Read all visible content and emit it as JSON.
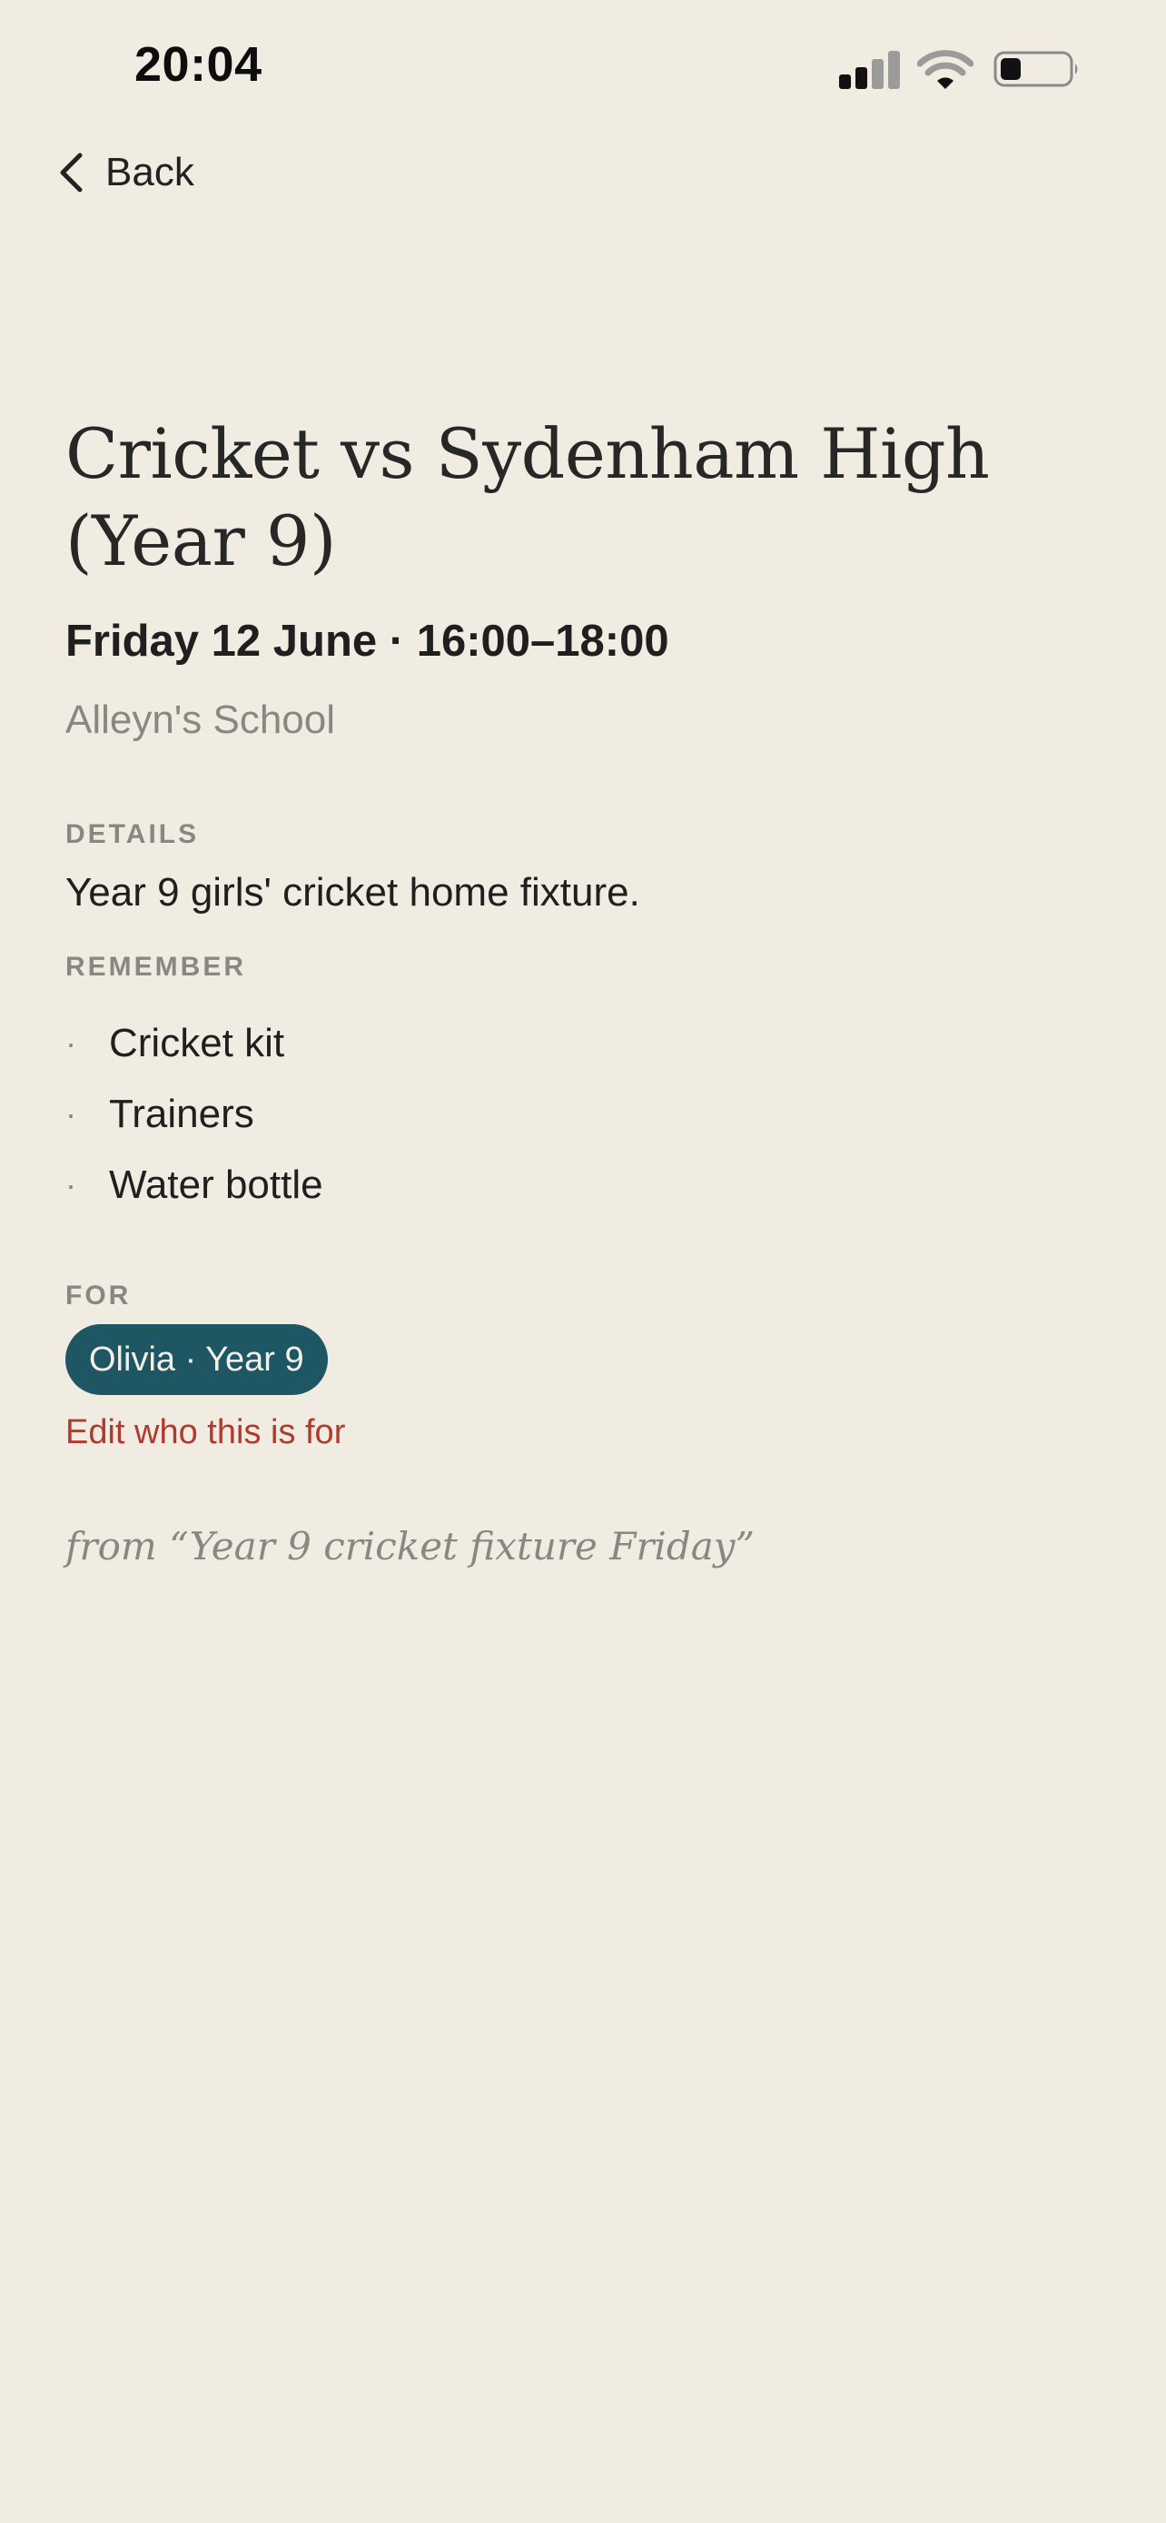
{
  "status_bar": {
    "time": "20:04",
    "icons": [
      "cellular-signal-icon",
      "wifi-icon",
      "battery-icon"
    ]
  },
  "nav": {
    "back_label": "Back",
    "back_icon": "chevron-left-icon"
  },
  "event": {
    "title": "Cricket vs Sydenham High (Year 9)",
    "datetime": "Friday 12 June · 16:00–18:00",
    "location": "Alleyn's School"
  },
  "details": {
    "label": "DETAILS",
    "text": "Year 9 girls' cricket home fixture."
  },
  "remember": {
    "label": "REMEMBER",
    "bullet": "·",
    "items": [
      "Cricket kit",
      "Trainers",
      "Water bottle"
    ]
  },
  "for": {
    "label": "FOR",
    "chip": "Olivia · Year 9",
    "edit_link": "Edit who this is for"
  },
  "source": {
    "text": "from “Year 9 cricket fixture Friday”"
  },
  "colors": {
    "background": "#f0ece2",
    "chip": "#1e5664",
    "link": "#b03a2e",
    "muted": "#8a8782"
  }
}
